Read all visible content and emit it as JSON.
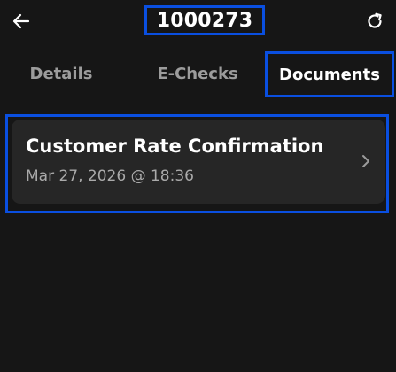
{
  "header": {
    "title": "1000273",
    "back_icon": "arrow-left-icon",
    "refresh_icon": "refresh-icon"
  },
  "tabs": [
    {
      "label": "Details",
      "selected": false
    },
    {
      "label": "E-Checks",
      "selected": false
    },
    {
      "label": "Documents",
      "selected": true
    }
  ],
  "documents": [
    {
      "title": "Customer Rate Confirmation",
      "date": "Mar 27, 2026 @ 18:36",
      "icon": "chevron-right-icon"
    }
  ],
  "colors": {
    "background": "#161616",
    "card": "#262626",
    "highlight": "#0a4fe0",
    "inactive_tab": "#9c9c9c",
    "secondary_text": "#aaaaaa"
  }
}
